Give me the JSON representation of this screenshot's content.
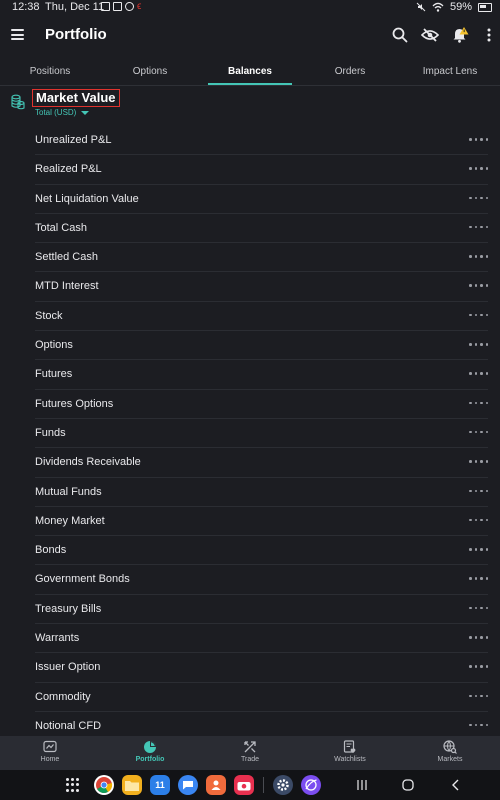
{
  "status": {
    "time": "12:38",
    "date": "Thu, Dec 11",
    "battery": "59%"
  },
  "header": {
    "title": "Portfolio"
  },
  "tabs": [
    {
      "label": "Positions"
    },
    {
      "label": "Options"
    },
    {
      "label": "Balances"
    },
    {
      "label": "Orders"
    },
    {
      "label": "Impact Lens"
    }
  ],
  "section": {
    "title": "Market Value",
    "currency": "Total (USD)"
  },
  "rows": [
    {
      "label": "Unrealized P&L"
    },
    {
      "label": "Realized P&L"
    },
    {
      "label": "Net Liquidation Value"
    },
    {
      "label": "Total Cash"
    },
    {
      "label": "Settled Cash"
    },
    {
      "label": "MTD Interest"
    },
    {
      "label": "Stock"
    },
    {
      "label": "Options"
    },
    {
      "label": "Futures"
    },
    {
      "label": "Futures Options"
    },
    {
      "label": "Funds"
    },
    {
      "label": "Dividends Receivable"
    },
    {
      "label": "Mutual Funds"
    },
    {
      "label": "Money Market"
    },
    {
      "label": "Bonds"
    },
    {
      "label": "Government Bonds"
    },
    {
      "label": "Treasury Bills"
    },
    {
      "label": "Warrants"
    },
    {
      "label": "Issuer Option"
    },
    {
      "label": "Commodity"
    },
    {
      "label": "Notional CFD"
    }
  ],
  "bottom_nav": [
    {
      "label": "Home",
      "icon": "home-chart-icon"
    },
    {
      "label": "Portfolio",
      "icon": "pie-chart-icon"
    },
    {
      "label": "Trade",
      "icon": "arrows-icon"
    },
    {
      "label": "Watchlists",
      "icon": "watchlist-icon"
    },
    {
      "label": "Markets",
      "icon": "globe-search-icon"
    }
  ],
  "dock": {
    "calendar_day": "11"
  },
  "colors": {
    "accent": "#44c6b6",
    "background": "#1c1d22",
    "highlight_box": "#e0332e"
  }
}
